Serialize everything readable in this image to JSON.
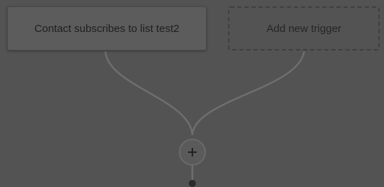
{
  "workflow": {
    "trigger_card": {
      "label": "Contact subscribes to list test2"
    },
    "add_trigger": {
      "label": "Add new trigger"
    },
    "add_step_button": {
      "icon": "plus-icon"
    }
  },
  "colors": {
    "overlay_background": "#535353",
    "connector_line": "#6e6e6e",
    "text": "#1f1f1f"
  }
}
